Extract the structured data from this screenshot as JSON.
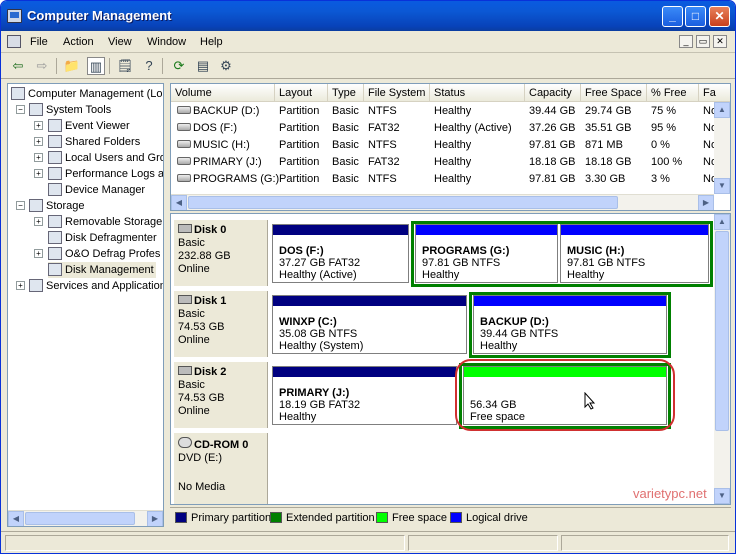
{
  "window": {
    "title": "Computer Management",
    "buttons": {
      "minimize": "_",
      "maximize": "□",
      "close": "✕"
    }
  },
  "menu": {
    "items": [
      "File",
      "Action",
      "View",
      "Window",
      "Help"
    ],
    "mdi": [
      "_",
      "▭",
      "✕"
    ]
  },
  "toolbar": {
    "icons": [
      "back-arrow-icon",
      "forward-arrow-icon",
      "up-folder-icon",
      "show-hide-tree-icon",
      "properties-icon",
      "help-icon",
      "refresh-icon",
      "export-list-icon",
      "settings-icon"
    ]
  },
  "tree": {
    "root": "Computer Management (Loc",
    "system_tools": "System Tools",
    "event_viewer": "Event Viewer",
    "shared_folders": "Shared Folders",
    "local_users": "Local Users and Gro",
    "performance_logs": "Performance Logs a",
    "device_manager": "Device Manager",
    "storage": "Storage",
    "removable_storage": "Removable Storage",
    "disk_defragmenter": "Disk Defragmenter",
    "oo_defrag": "O&O Defrag Profes",
    "disk_management": "Disk Management",
    "services": "Services and Application"
  },
  "volume_list": {
    "columns": [
      "Volume",
      "Layout",
      "Type",
      "File System",
      "Status",
      "Capacity",
      "Free Space",
      "% Free",
      "Fa"
    ],
    "rows": [
      {
        "volume": "BACKUP (D:)",
        "layout": "Partition",
        "type": "Basic",
        "fs": "NTFS",
        "status": "Healthy",
        "capacity": "39.44 GB",
        "free": "29.74 GB",
        "pct": "75 %",
        "fa": "No"
      },
      {
        "volume": "DOS (F:)",
        "layout": "Partition",
        "type": "Basic",
        "fs": "FAT32",
        "status": "Healthy (Active)",
        "capacity": "37.26 GB",
        "free": "35.51 GB",
        "pct": "95 %",
        "fa": "No"
      },
      {
        "volume": "MUSIC (H:)",
        "layout": "Partition",
        "type": "Basic",
        "fs": "NTFS",
        "status": "Healthy",
        "capacity": "97.81 GB",
        "free": "871 MB",
        "pct": "0 %",
        "fa": "No"
      },
      {
        "volume": "PRIMARY (J:)",
        "layout": "Partition",
        "type": "Basic",
        "fs": "FAT32",
        "status": "Healthy",
        "capacity": "18.18 GB",
        "free": "18.18 GB",
        "pct": "100 %",
        "fa": "No"
      },
      {
        "volume": "PROGRAMS (G:)",
        "layout": "Partition",
        "type": "Basic",
        "fs": "NTFS",
        "status": "Healthy",
        "capacity": "97.81 GB",
        "free": "3.30 GB",
        "pct": "3 %",
        "fa": "No"
      }
    ]
  },
  "disks": {
    "disk0": {
      "name": "Disk 0",
      "type": "Basic",
      "size": "232.88 GB",
      "state": "Online",
      "p1": {
        "name": "DOS  (F:)",
        "size": "37.27 GB FAT32",
        "status": "Healthy (Active)"
      },
      "p2": {
        "name": "PROGRAMS  (G:)",
        "size": "97.81 GB NTFS",
        "status": "Healthy"
      },
      "p3": {
        "name": "MUSIC  (H:)",
        "size": "97.81 GB NTFS",
        "status": "Healthy"
      }
    },
    "disk1": {
      "name": "Disk 1",
      "type": "Basic",
      "size": "74.53 GB",
      "state": "Online",
      "p1": {
        "name": "WINXP  (C:)",
        "size": "35.08 GB NTFS",
        "status": "Healthy (System)"
      },
      "p2": {
        "name": "BACKUP  (D:)",
        "size": "39.44 GB NTFS",
        "status": "Healthy"
      }
    },
    "disk2": {
      "name": "Disk 2",
      "type": "Basic",
      "size": "74.53 GB",
      "state": "Online",
      "p1": {
        "name": "PRIMARY  (J:)",
        "size": "18.19 GB FAT32",
        "status": "Healthy"
      },
      "p2": {
        "size": "56.34 GB",
        "status": "Free space"
      }
    },
    "cdrom": {
      "name": "CD-ROM 0",
      "drive": "DVD (E:)",
      "media": "No Media"
    }
  },
  "legend": [
    {
      "label": "Primary partition",
      "color": "#000080"
    },
    {
      "label": "Extended partition",
      "color": "#008000"
    },
    {
      "label": "Free space",
      "color": "#00ff00"
    },
    {
      "label": "Logical drive",
      "color": "#0000ff"
    }
  ],
  "watermark": "varietypc.net"
}
